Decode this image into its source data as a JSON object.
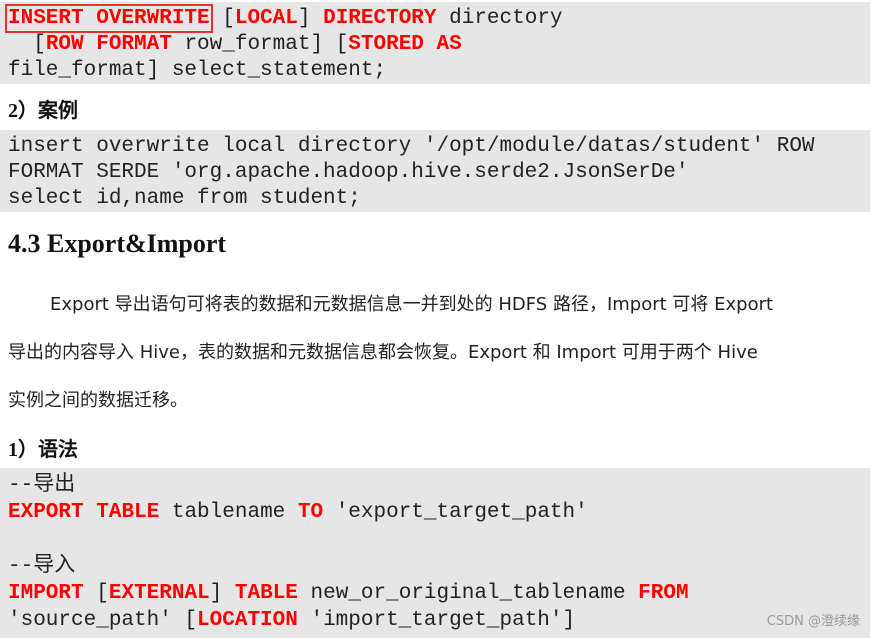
{
  "syntax_block": {
    "l1_kw1": "INSERT OVERWRITE",
    "l1_t1": " [",
    "l1_kw2": "LOCAL",
    "l1_t2": "] ",
    "l1_kw3": "DIRECTORY",
    "l1_t3": " directory",
    "l2_t0": "  [",
    "l2_kw1": "ROW FORMAT",
    "l2_t1": " row_format] [",
    "l2_kw2": "STORED AS",
    "l3_t0": "file_format] select_statement;"
  },
  "case_heading": "2）案例",
  "case_block": {
    "l1": "insert overwrite local directory '/opt/module/datas/student' ROW",
    "l2": "FORMAT SERDE 'org.apache.hadoop.hive.serde2.JsonSerDe'",
    "l3": "select id,name from student;"
  },
  "section_heading": "4.3 Export&Import",
  "paragraph": {
    "l1": "Export 导出语句可将表的数据和元数据信息一并到处的 HDFS 路径，Import 可将 Export",
    "l2": "导出的内容导入 Hive，表的数据和元数据信息都会恢复。Export 和 Import 可用于两个 Hive",
    "l3": "实例之间的数据迁移。"
  },
  "syntax_heading": "1）语法",
  "export_block": {
    "c1": "--导出",
    "e_kw1": "EXPORT",
    "e_kw2": "TABLE",
    "e_t1": " tablename ",
    "e_kw3": "TO",
    "e_t2": " 'export_target_path'",
    "c2": "--导入",
    "i_kw1": "IMPORT",
    "i_t1": " [",
    "i_kw2": "EXTERNAL",
    "i_t2": "] ",
    "i_kw3": "TABLE",
    "i_t3": " new_or_original_tablename ",
    "i_kw4": "FROM",
    "i2_t1": "'source_path' [",
    "i2_kw1": "LOCATION",
    "i2_t2": " 'import_target_path']"
  },
  "watermark": "CSDN @澄续缘",
  "colors": {
    "keyword": "#ff0000",
    "code_bg": "#e6e6e6",
    "highlight_box": "#e8322a"
  }
}
